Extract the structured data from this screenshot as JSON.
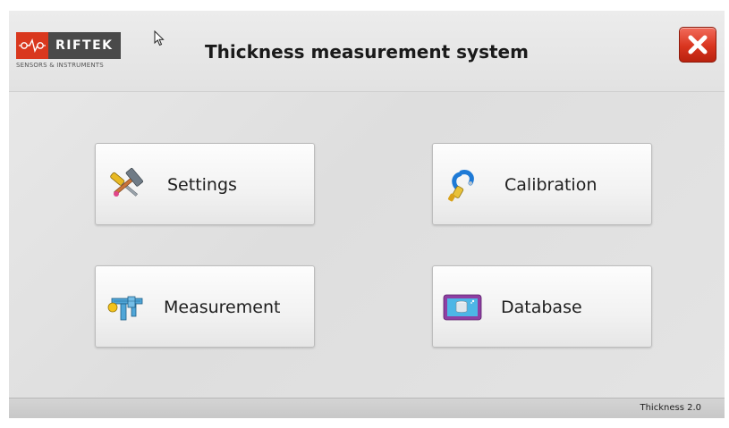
{
  "header": {
    "logo_name": "RIFTEK",
    "logo_tagline": "SENSORS & INSTRUMENTS",
    "title": "Thickness measurement system",
    "close_icon": "close-icon"
  },
  "menu": {
    "settings": {
      "label": "Settings",
      "icon": "tools-icon"
    },
    "calibration": {
      "label": "Calibration",
      "icon": "micrometer-icon"
    },
    "measurement": {
      "label": "Measurement",
      "icon": "caliper-icon"
    },
    "database": {
      "label": "Database",
      "icon": "database-monitor-icon"
    }
  },
  "footer": {
    "version": "Thickness 2.0"
  },
  "colors": {
    "brand_red": "#d9381e",
    "brand_dark": "#4a4a4a",
    "close_red": "#d9351f"
  }
}
